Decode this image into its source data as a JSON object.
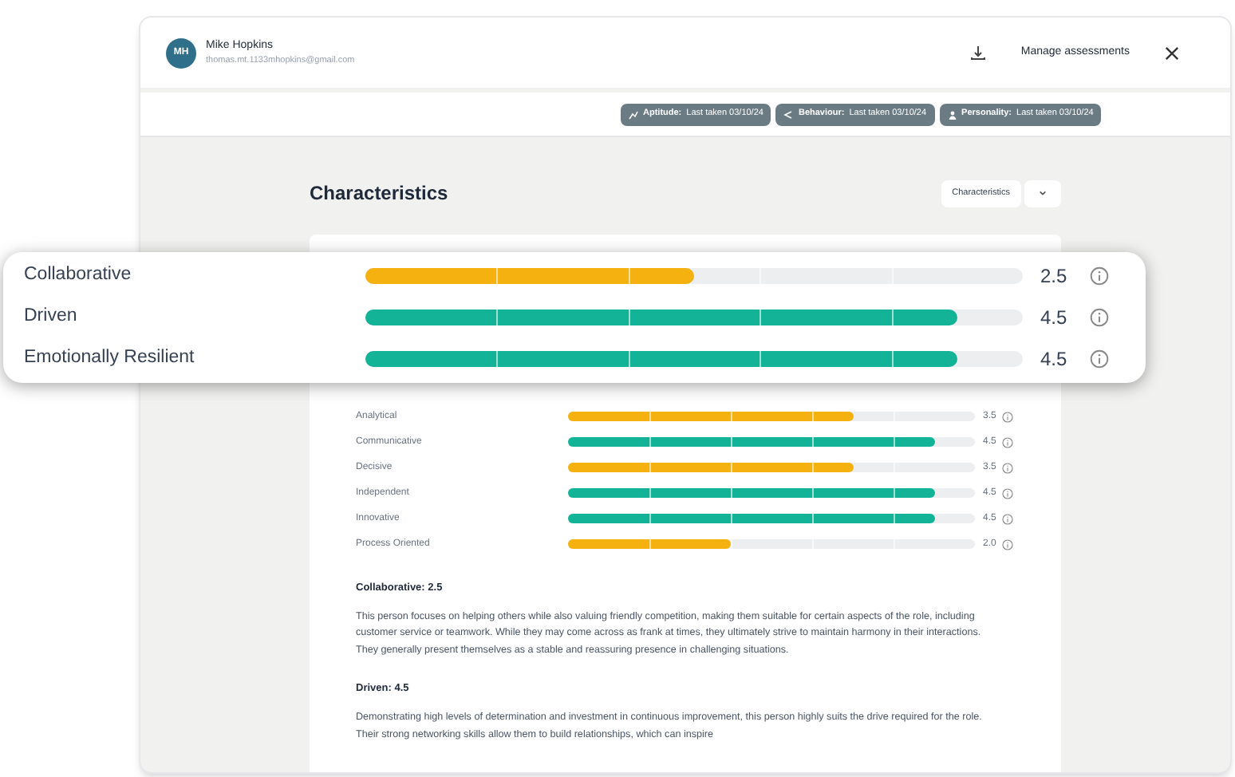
{
  "header": {
    "avatar_initials": "MH",
    "name": "Mike Hopkins",
    "email": "thomas.mt.1133mhopkins@gmail.com",
    "manage_link": "Manage assessments"
  },
  "assessments": [
    {
      "label": "Aptitude:",
      "detail": "Last taken 03/10/24"
    },
    {
      "label": "Behaviour:",
      "detail": "Last taken 03/10/24"
    },
    {
      "label": "Personality:",
      "detail": "Last taken 03/10/24"
    }
  ],
  "section": {
    "title": "Characteristics",
    "dropdown": "Characteristics"
  },
  "highlighted_traits": [
    {
      "name": "Collaborative",
      "score": "2.5",
      "level": 0.5,
      "color": "#f5b10f"
    },
    {
      "name": "Driven",
      "score": "4.5",
      "level": 0.9,
      "color": "#12b397"
    },
    {
      "name": "Emotionally Resilient",
      "score": "4.5",
      "level": 0.9,
      "color": "#12b397"
    }
  ],
  "traits": [
    {
      "name": "Analytical",
      "score": "3.5",
      "level": 0.7,
      "color": "#f5b10f"
    },
    {
      "name": "Communicative",
      "score": "4.5",
      "level": 0.9,
      "color": "#12b397"
    },
    {
      "name": "Decisive",
      "score": "3.5",
      "level": 0.7,
      "color": "#f5b10f"
    },
    {
      "name": "Independent",
      "score": "4.5",
      "level": 0.9,
      "color": "#12b397"
    },
    {
      "name": "Innovative",
      "score": "4.5",
      "level": 0.9,
      "color": "#12b397"
    },
    {
      "name": "Process Oriented",
      "score": "2.0",
      "level": 0.4,
      "color": "#f5b10f"
    }
  ],
  "descriptions": [
    {
      "heading": "Collaborative: 2.5",
      "text": "This person focuses on helping others while also valuing friendly competition, making them suitable for certain aspects of the role, including customer service or teamwork. While they may come across as frank at times, they ultimately strive to maintain harmony in their interactions. They generally present themselves as a stable and reassuring presence in challenging situations."
    },
    {
      "heading": "Driven: 4.5",
      "text": "Demonstrating high levels of determination and investment in continuous improvement, this person highly suits the drive required for the role. Their strong networking skills allow them to build relationships, which can inspire"
    }
  ]
}
